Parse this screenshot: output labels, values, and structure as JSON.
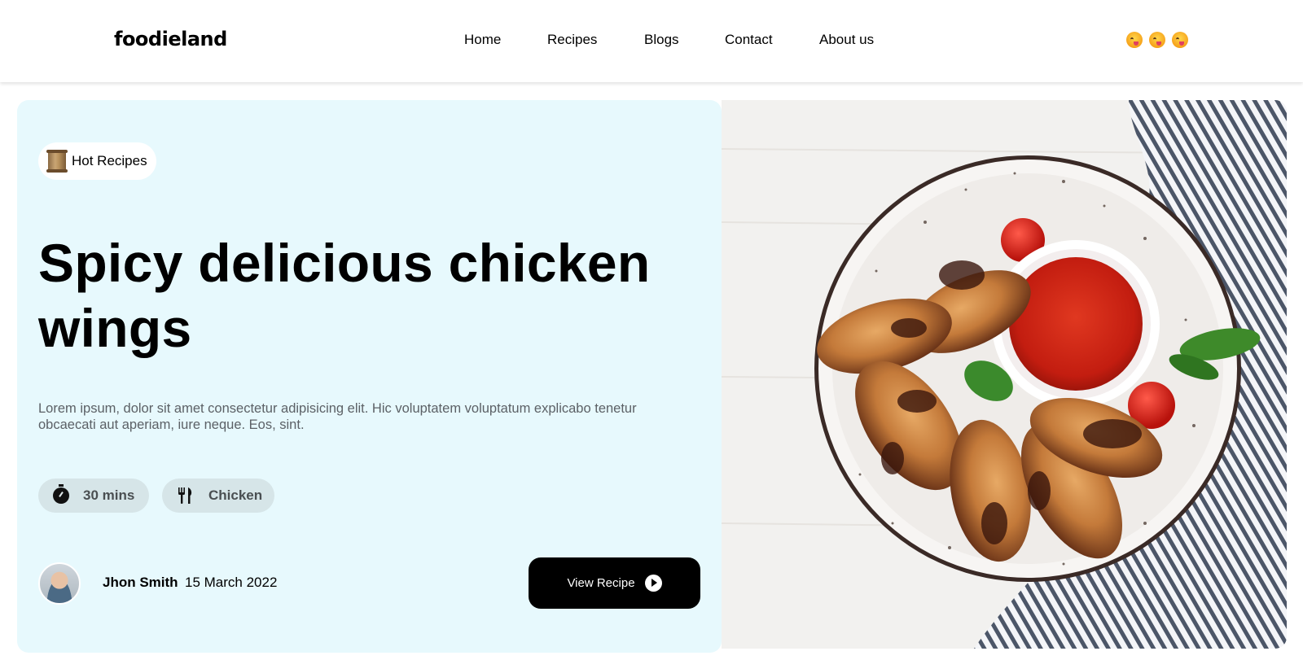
{
  "header": {
    "logo": "foodieland",
    "nav": [
      {
        "label": "Home"
      },
      {
        "label": "Recipes"
      },
      {
        "label": "Blogs"
      },
      {
        "label": "Contact"
      },
      {
        "label": "About us"
      }
    ],
    "social_icons": [
      "face-with-tongue-icon",
      "face-with-tongue-icon",
      "face-with-tongue-icon"
    ]
  },
  "hero": {
    "tag_icon": "scroll-icon",
    "tag_label": "Hot Recipes",
    "title": "Spicy delicious chicken wings",
    "description": "Lorem ipsum, dolor sit amet consectetur adipisicing elit. Hic voluptatem voluptatum explicabo tenetur obcaecati aut aperiam, iure neque. Eos, sint.",
    "chips": [
      {
        "icon": "timer-icon",
        "label": "30 mins"
      },
      {
        "icon": "fork-knife-icon",
        "label": "Chicken"
      }
    ],
    "author": {
      "name": "Jhon Smith",
      "date": "15 March 2022"
    },
    "button_label": "View Recipe",
    "image_subject": "plate of grilled chicken wings with red dipping sauce",
    "colors": {
      "panel_bg": "#e7f9fd",
      "chip_bg": "#d6e5e8",
      "button_bg": "#000000"
    }
  }
}
